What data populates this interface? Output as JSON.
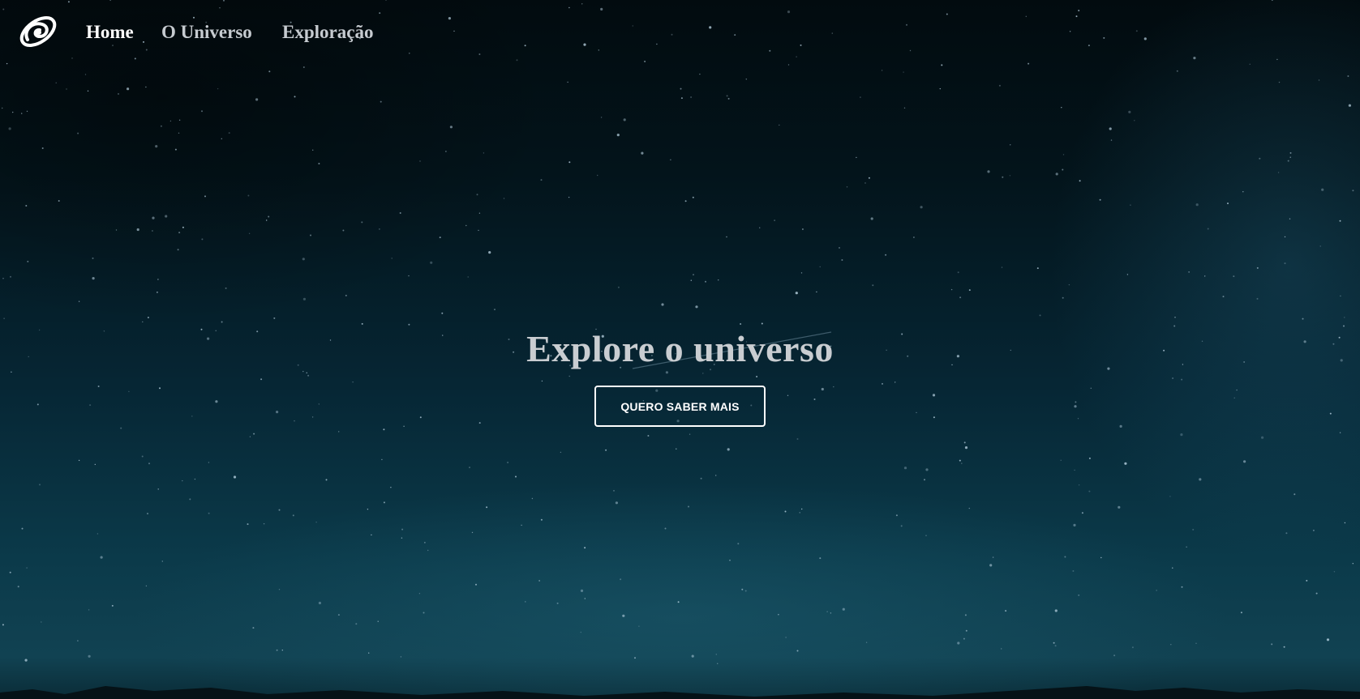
{
  "nav": {
    "logo_icon": "galaxy-swirl-logo",
    "links": [
      {
        "label": "Home",
        "active": true
      },
      {
        "label": "O Universo",
        "active": false
      },
      {
        "label": "Exploração",
        "active": false
      }
    ]
  },
  "hero": {
    "title": "Explore o universo",
    "button_label": "QUERO SABER MAIS"
  },
  "colors": {
    "background_top": "#020b0f",
    "background_bottom": "#114252",
    "nav_active": "#ffffff",
    "nav_inactive": "#c6cbd0",
    "title": "#c9cdd1",
    "button_border": "#ffffff"
  }
}
